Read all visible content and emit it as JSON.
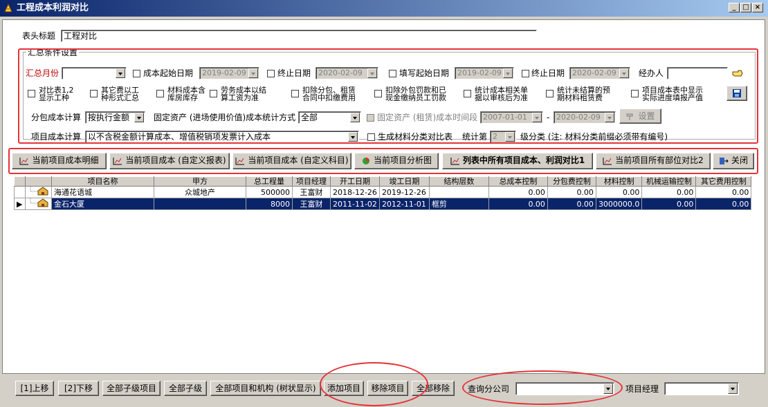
{
  "window": {
    "title": "工程成本利润对比"
  },
  "header": {
    "label": "表头标题",
    "value": "工程对比"
  },
  "conditions": {
    "group_title": "汇总条件设置",
    "summary_month_label": "汇总月份",
    "summary_month_value": "",
    "cost_start_label": "成本起始日期",
    "cost_start_value": "2019-02-09",
    "end_label_1": "终止日期",
    "end_value_1": "2020-02-09",
    "fill_start_label": "填写起始日期",
    "fill_start_value": "2019-02-09",
    "end_label_2": "终止日期",
    "end_value_2": "2020-02-09",
    "handler_label": "经办人",
    "handler_value": "",
    "options": [
      {
        "l1": "对比表1,2",
        "l2": "显示工种"
      },
      {
        "l1": "其它费以工",
        "l2": "种形式汇总"
      },
      {
        "l1": "材料成本含",
        "l2": "库房库存"
      },
      {
        "l1": "劳务成本以结",
        "l2": "算工资为准"
      },
      {
        "l1": "扣除分包、租赁",
        "l2": "合同中扣缴费用"
      },
      {
        "l1": "扣除外包罚款和已",
        "l2": "现金缴纳员工罚款"
      },
      {
        "l1": "统计成本相关单",
        "l2": "据以审核后为准"
      },
      {
        "l1": "统计未结算的预",
        "l2": "期材料租赁费"
      },
      {
        "l1": "项目成本表中显示",
        "l2": "实际进度填报产值"
      }
    ],
    "subcontract_label": "分包成本计算",
    "subcontract_value": "按执行金额",
    "fixed_asset_label": "固定资产 (进场使用价值)成本统计方式",
    "fixed_asset_value": "全部",
    "rent_period_label": "固定资产 (租赁)成本时间段",
    "rent_start": "2007-01-01",
    "rent_sep": "-",
    "rent_end": "2020-02-09",
    "setting_label": "设置",
    "project_cost_label": "项目成本计算",
    "project_cost_value": "以不含税金额计算成本、增值税销项发票计入成本",
    "gen_material_label": "生成材料分类对比表",
    "stat_label": "统计第",
    "stat_level": "2",
    "level_note": "级分类 (注: 材料分类前缀必须带有编号)"
  },
  "actions": [
    "当前项目成本明细",
    "当前项目成本 (自定义报表)",
    "当前项目成本 (自定义科目)",
    "当前项目分析图",
    "列表中所有项目成本、利润对比1",
    "当前项目所有部位对比2",
    "关闭"
  ],
  "table": {
    "columns": [
      "项目名称",
      "甲方",
      "总工程量",
      "项目经理",
      "开工日期",
      "竣工日期",
      "结构层数",
      "总成本控制",
      "分包费控制",
      "材料控制",
      "机械运输控制",
      "其它费用控制"
    ],
    "rows": [
      [
        "海通花语城",
        "众城地产",
        "500000",
        "王富财",
        "2018-12-26",
        "2019-12-26",
        "",
        "0.00",
        "0.00",
        "0.00",
        "0.00",
        "0.00"
      ],
      [
        "金石大厦",
        "",
        "8000",
        "王富财",
        "2011-11-02",
        "2012-11-01",
        "框剪",
        "0.00",
        "0.00",
        "3000000.0",
        "0.00",
        "0.00"
      ]
    ]
  },
  "bottom": {
    "buttons": [
      "[1]上移",
      "[2]下移",
      "全部子级项目",
      "全部子级",
      "全部项目和机构 (树状显示)",
      "添加项目",
      "移除项目",
      "全部移除"
    ],
    "branch_label": "查询分公司",
    "branch_value": "",
    "manager_label": "项目经理",
    "manager_value": ""
  },
  "colors": {
    "title_bar": "#0a246a",
    "selection": "#0a246a",
    "highlight": "#e53238",
    "required_label": "#c00000"
  }
}
